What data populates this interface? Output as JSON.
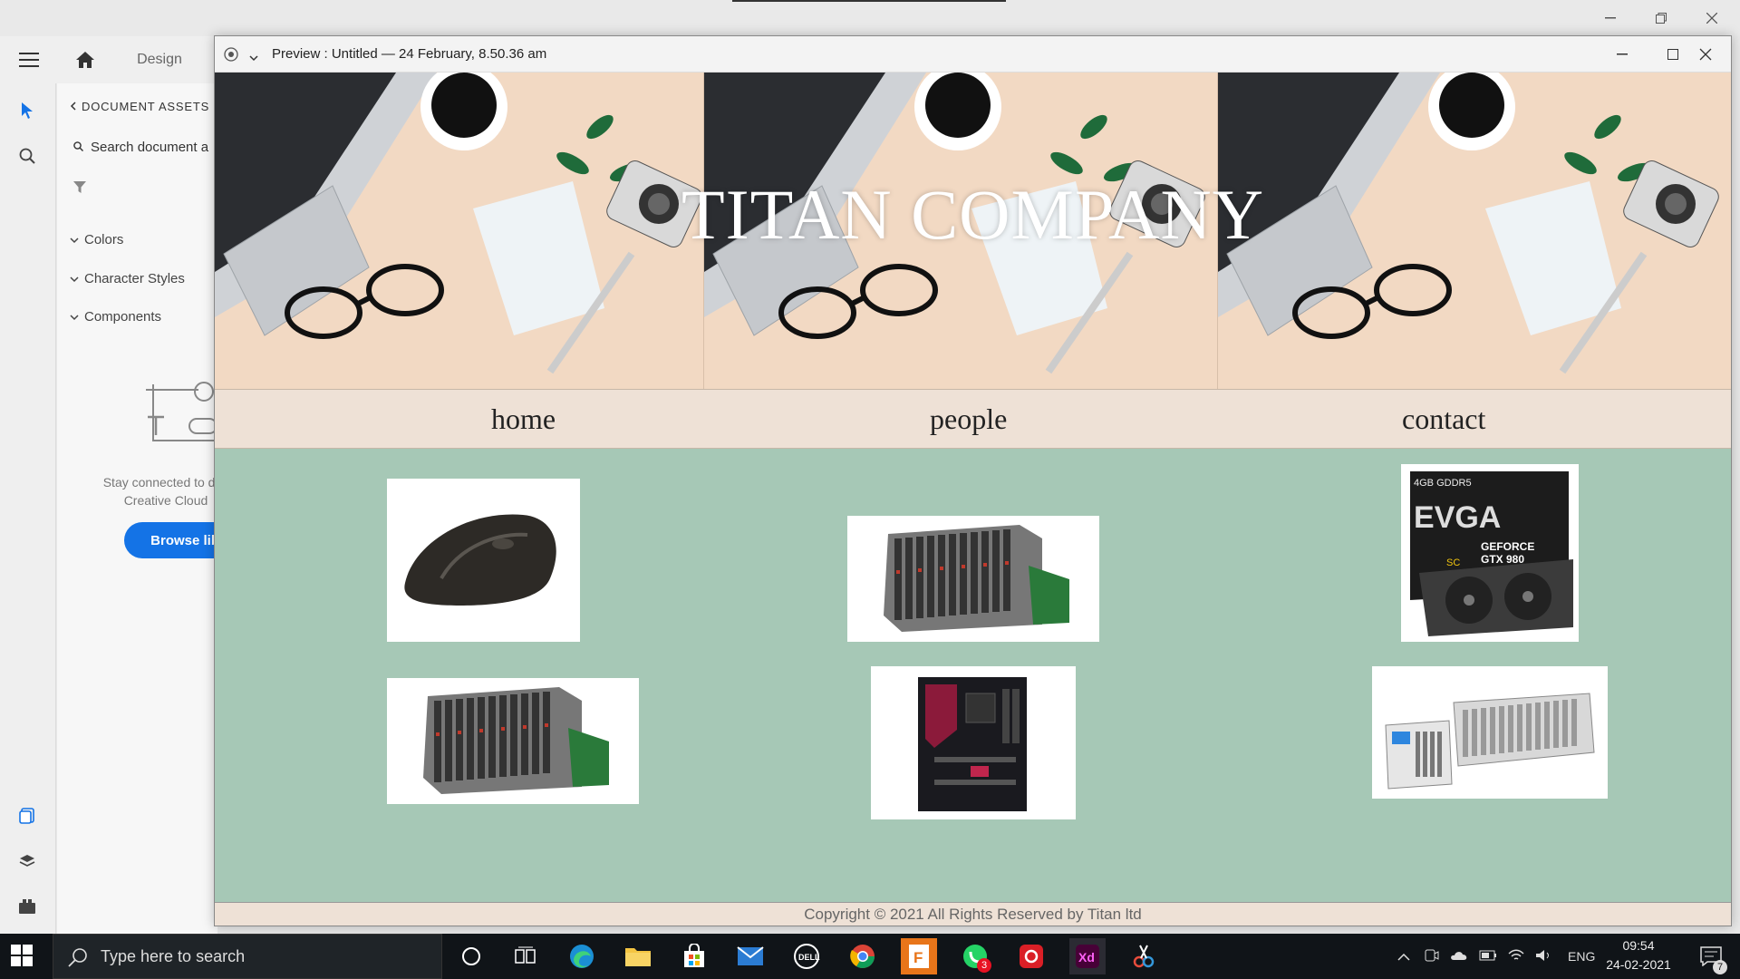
{
  "app": {
    "toolbar": {
      "mode_label": "Design"
    },
    "assets_panel": {
      "header": "DOCUMENT ASSETS",
      "search_placeholder": "Search document a",
      "sections": [
        "Colors",
        "Character Styles",
        "Components"
      ],
      "empty_text_1": "Stay connected to des",
      "empty_text_2": "Creative Cloud",
      "browse_label": "Browse libr"
    }
  },
  "preview": {
    "title": "Preview : Untitled — 24 February, 8.50.36 am"
  },
  "site": {
    "hero_title": "TITAN COMPANY",
    "nav": [
      "home",
      "people",
      "contact"
    ],
    "products": [
      {
        "name": "wireless mouse"
      },
      {
        "name": "blade server chassis"
      },
      {
        "name": "EVGA GeForce GTX 980 graphics card",
        "box_top_text": "4GB GDDR5",
        "brand": "EVGA",
        "model_line1": "GEFORCE",
        "model_line2": "GTX 980",
        "badge": "SC"
      },
      {
        "name": "blade server chassis"
      },
      {
        "name": "gaming motherboard"
      },
      {
        "name": "PXI instrument chassis"
      }
    ],
    "footer": "Copyright © 2021 All Rights Reserved by Titan ltd"
  },
  "taskbar": {
    "search_placeholder": "Type here to search",
    "language": "ENG",
    "time": "09:54",
    "date": "24-02-2021",
    "whatsapp_badge": "3",
    "notification_count": "7"
  },
  "colors": {
    "accent": "#1473e6",
    "product_bg": "#a6c8b6",
    "nav_bg": "#eee1d6",
    "xd_brand": "#470137"
  }
}
